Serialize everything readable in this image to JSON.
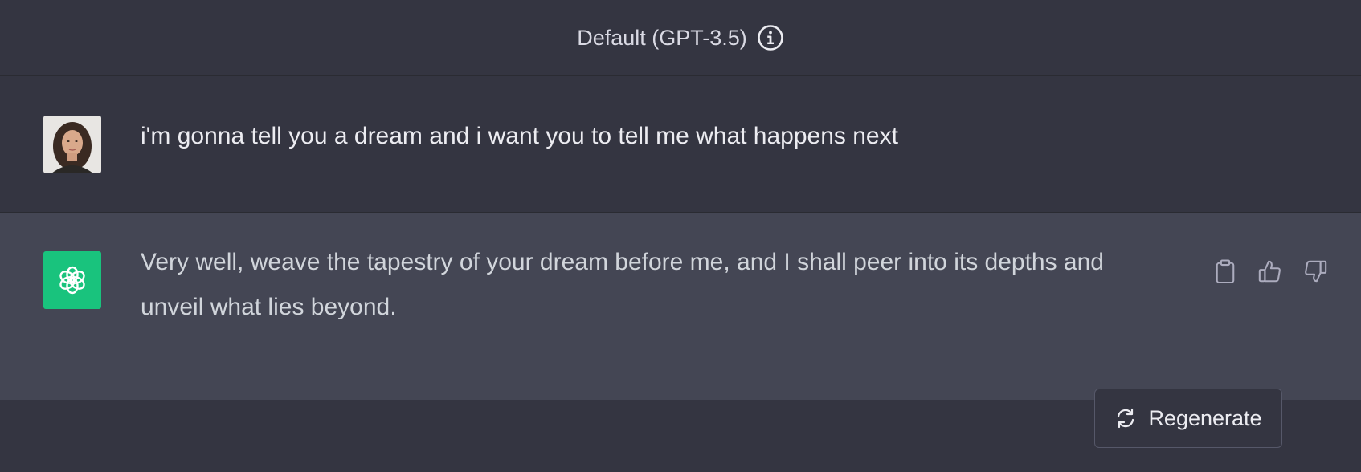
{
  "header": {
    "model_title": "Default (GPT-3.5)",
    "info_icon": "info-icon"
  },
  "conversation": {
    "user_message": {
      "avatar": "user-avatar",
      "text": "i'm gonna tell you a dream and i want you to tell me what happens next"
    },
    "assistant_message": {
      "avatar": "openai-logo-icon",
      "text": "Very well, weave the tapestry of your dream before me, and I shall peer into its depths and unveil what lies beyond.",
      "actions": [
        "clipboard-icon",
        "thumbs-up-icon",
        "thumbs-down-icon"
      ]
    }
  },
  "footer": {
    "regenerate_label": "Regenerate",
    "regenerate_icon": "refresh-icon"
  },
  "colors": {
    "background": "#343541",
    "assistant_row": "#444654",
    "openai_green": "#19c37d",
    "text_primary": "#ececf1",
    "text_secondary": "#d1d5db"
  }
}
